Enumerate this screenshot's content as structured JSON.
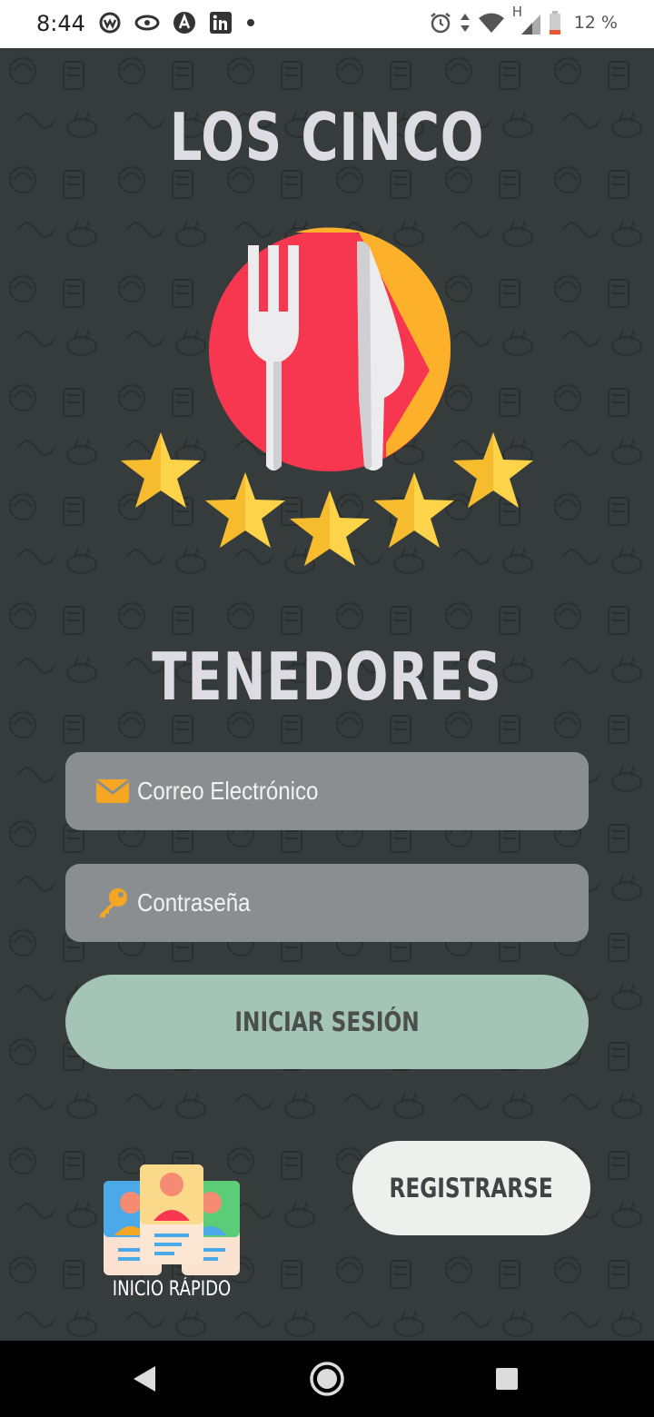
{
  "status_bar": {
    "time": "8:44",
    "notification_icons": [
      "wear-icon",
      "eye-icon",
      "angular-icon",
      "linkedin-icon",
      "dot-icon"
    ],
    "system_icons": [
      "alarm-icon",
      "data-arrows-icon",
      "wifi-icon",
      "network-type-h",
      "signal-icon",
      "battery-icon"
    ],
    "network_type": "H",
    "battery_text": "12 %"
  },
  "app": {
    "title_top": "LOS CINCO",
    "title_bottom": "TENEDORES",
    "email_placeholder": "Correo Electrónico",
    "password_placeholder": "Contraseña",
    "login_label": "INICIAR SESIÓN",
    "register_label": "REGISTRARSE",
    "quick_login_label": "INICIO RÁPIDO",
    "colors": {
      "background": "#363c3b",
      "title": "#dcdce2",
      "field": "#8b8e90",
      "login_button": "#a4c4b5",
      "register_button": "#eef0ee",
      "accent_icon": "#f5a623",
      "logo_red": "#f7374f",
      "logo_orange": "#fdb12b",
      "star": "#fcd349"
    }
  },
  "nav_bar": {
    "icons": [
      "back-icon",
      "home-icon",
      "recents-icon"
    ]
  }
}
